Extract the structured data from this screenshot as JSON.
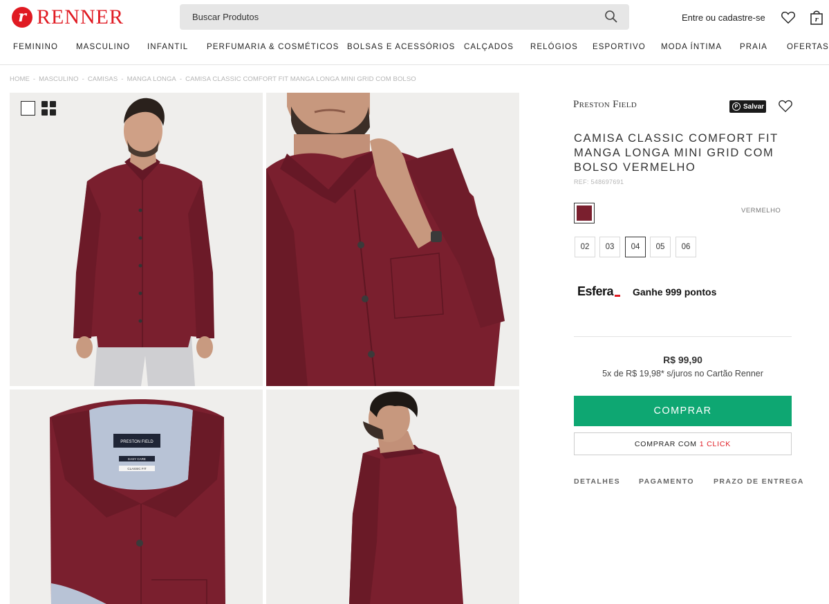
{
  "header": {
    "logo_letter": "r",
    "logo_text": "RENNER",
    "search_placeholder": "Buscar Produtos",
    "login_label": "Entre ou cadastre-se",
    "icons": [
      "search-icon",
      "heart-icon",
      "shopping-bag-icon"
    ]
  },
  "nav": {
    "items": [
      "FEMININO",
      "MASCULINO",
      "INFANTIL",
      "PERFUMARIA & COSMÉTICOS",
      "BOLSAS E ACESSÓRIOS",
      "CALÇADOS",
      "RELÓGIOS",
      "ESPORTIVO",
      "MODA ÍNTIMA",
      "PRAIA",
      "OFERTAS"
    ]
  },
  "breadcrumb": [
    "HOME",
    "MASCULINO",
    "CAMISAS",
    "MANGA LONGA",
    "CAMISA CLASSIC COMFORT FIT MANGA LONGA MINI GRID COM BOLSO"
  ],
  "gallery": {
    "label_brand": "PRESTON FIELD",
    "label_tag1": "EASY CARE",
    "label_tag2": "CLASSIC FIT"
  },
  "product": {
    "brand": "Preston Field",
    "save_label": "Salvar",
    "title": "CAMISA CLASSIC COMFORT FIT MANGA LONGA MINI GRID COM BOLSO VERMELHO",
    "ref": "REF: 548697691",
    "color_name": "VERMELHO",
    "color_hex": "#7a1f2e",
    "sizes": [
      "02",
      "03",
      "04",
      "05",
      "06"
    ],
    "selected_size": "04",
    "esfera_logo": "Esfera",
    "esfera_text": "Ganhe 999 pontos",
    "price": "R$ 99,90",
    "installments": "5x de R$ 19,98* s/juros no Cartão Renner",
    "buy_label": "COMPRAR",
    "oneclick_label": "COMPRAR COM",
    "oneclick_highlight": "1 CLICK",
    "tabs": [
      "DETALHES",
      "PAGAMENTO",
      "PRAZO DE ENTREGA"
    ]
  },
  "colors": {
    "brand_red": "#e01a22",
    "buy_green": "#0ea772",
    "shirt": "#7a1f2e"
  }
}
